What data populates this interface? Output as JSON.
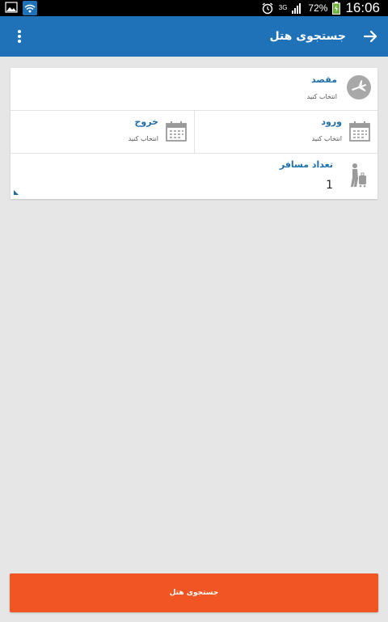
{
  "status_bar": {
    "network": "3G",
    "battery": "72%",
    "time": "16:06"
  },
  "appbar": {
    "title": "جستجوی هتل"
  },
  "form": {
    "destination": {
      "label": "مقصد",
      "value": "انتخاب کنید"
    },
    "checkin": {
      "label": "ورود",
      "value": "انتخاب کنید"
    },
    "checkout": {
      "label": "خروج",
      "value": "انتخاب کنید"
    },
    "passengers": {
      "label": "تعداد مسافر",
      "value": "1"
    }
  },
  "search_button": {
    "label": "جستجوی هتل"
  },
  "colors": {
    "appbar": "#1f72b8",
    "button": "#f15524",
    "label": "#1e6fa8",
    "background": "#e6e6e6"
  }
}
